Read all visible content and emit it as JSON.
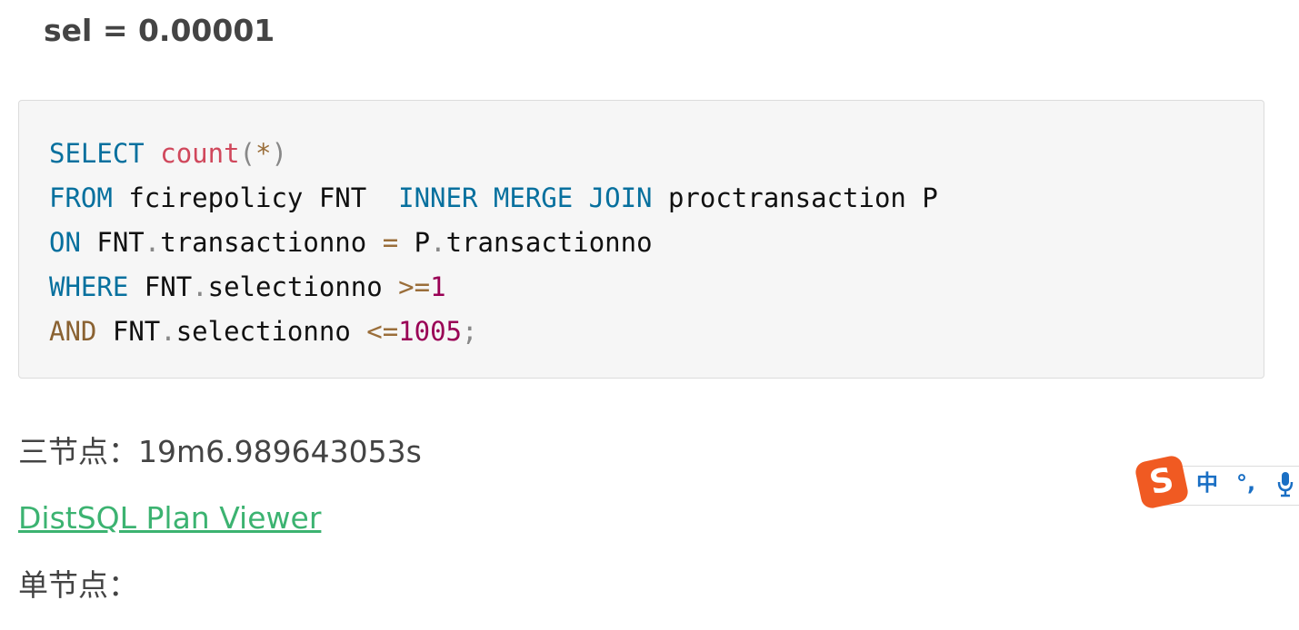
{
  "heading": "sel = 0.00001",
  "code": {
    "line1": {
      "kw": "SELECT",
      "fn": "count",
      "open": "(",
      "star": "*",
      "close": ")"
    },
    "line2": {
      "from": "FROM",
      "table1": "fcirepolicy FNT",
      "join": "INNER MERGE JOIN",
      "table2": "proctransaction P"
    },
    "line3": {
      "on": "ON",
      "a_alias": "FNT",
      "dot1": ".",
      "a_col": "transactionno",
      "eq": "=",
      "b_alias": "P",
      "dot2": ".",
      "b_col": "transactionno"
    },
    "line4": {
      "where": "WHERE",
      "alias": "FNT",
      "dot": ".",
      "col": "selectionno",
      "op": ">=",
      "val": "1"
    },
    "line5": {
      "and": "AND",
      "alias": "FNT",
      "dot": ".",
      "col": "selectionno",
      "op": "<=",
      "val": "1005",
      "semi": ";"
    }
  },
  "results": {
    "three_node": "三节点：19m6.989643053s",
    "link_text": "DistSQL Plan Viewer",
    "single_node": "单节点："
  },
  "ime": {
    "logo": "S",
    "lang": "中",
    "punct": "°,",
    "icons": [
      "sogou-logo-icon",
      "microphone-icon"
    ],
    "brand_color": "#f05a22",
    "text_color": "#1a6fc4"
  },
  "colors": {
    "link": "#3cb371",
    "keyword": "#07709e",
    "function": "#d0485c",
    "number": "#990055"
  }
}
